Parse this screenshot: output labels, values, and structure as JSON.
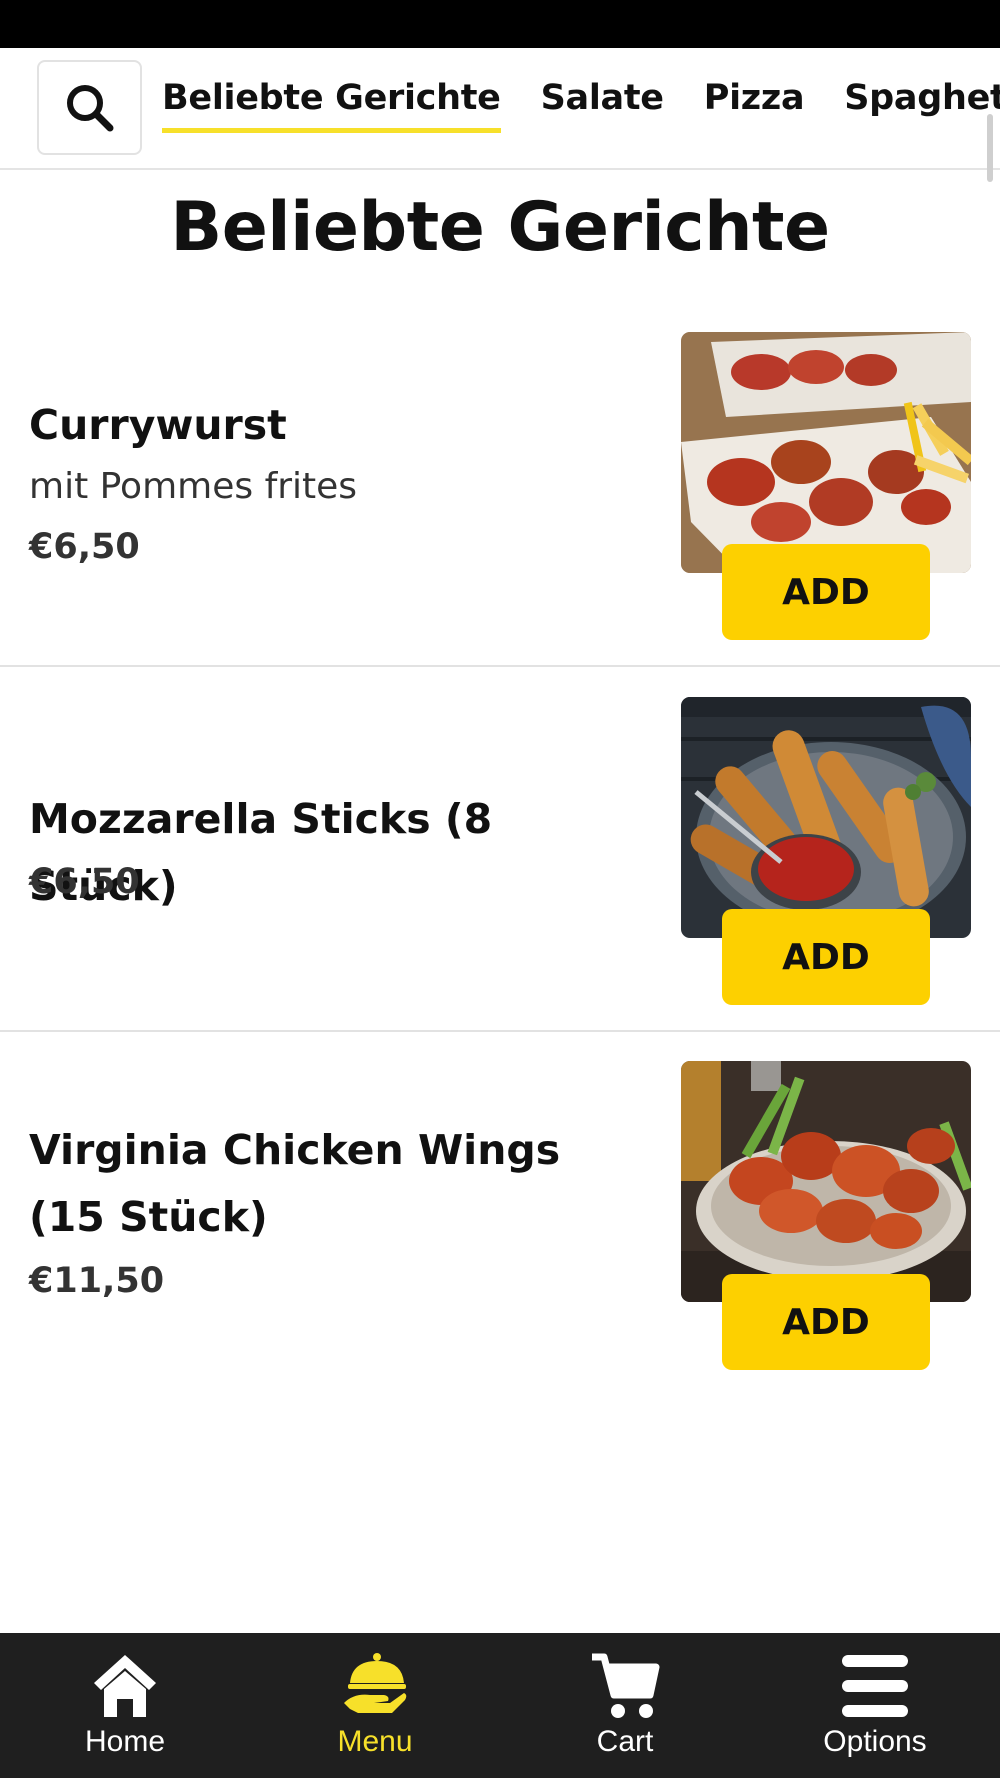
{
  "categories": {
    "tabs": [
      {
        "label": "Beliebte Gerichte",
        "active": true
      },
      {
        "label": "Salate",
        "active": false
      },
      {
        "label": "Pizza",
        "active": false
      },
      {
        "label": "Spaghetti",
        "active": false
      }
    ],
    "search_icon": "search-icon"
  },
  "section": {
    "title": "Beliebte Gerichte"
  },
  "items": [
    {
      "name": "Currywurst",
      "description": "mit Pommes frites",
      "price": "€6,50",
      "add_label": "ADD",
      "image": "currywurst-photo"
    },
    {
      "name": "Mozzarella Sticks (8 Stück)",
      "description": "",
      "price": "€6,50",
      "add_label": "ADD",
      "image": "mozzarella-sticks-photo"
    },
    {
      "name": "Virginia Chicken Wings (15 Stück)",
      "description": "",
      "price": "€11,50",
      "add_label": "ADD",
      "image": "chicken-wings-photo"
    }
  ],
  "bottom_nav": [
    {
      "label": "Home",
      "icon": "home-icon",
      "active": false
    },
    {
      "label": "Menu",
      "icon": "serving-cloche-icon",
      "active": true
    },
    {
      "label": "Cart",
      "icon": "cart-icon",
      "active": false
    },
    {
      "label": "Options",
      "icon": "menu-lines-icon",
      "active": false
    }
  ],
  "colors": {
    "accent": "#fdd000",
    "tab_underline": "#f7e02a",
    "nav_background": "#1f1f1f",
    "status_bar": "#000000"
  }
}
